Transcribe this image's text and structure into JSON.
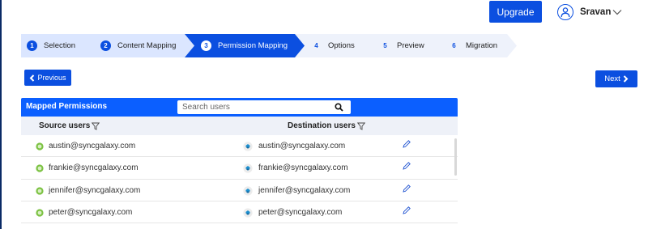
{
  "header": {
    "upgrade_label": "Upgrade",
    "user_name": "Sravan",
    "user_icon": "user-circle-icon",
    "chevron_icon": "chevron-down-icon"
  },
  "stepper": {
    "steps": [
      {
        "number": "1",
        "label": "Selection",
        "state": "completed"
      },
      {
        "number": "2",
        "label": "Content Mapping",
        "state": "completed"
      },
      {
        "number": "3",
        "label": "Permission Mapping",
        "state": "active"
      },
      {
        "number": "4",
        "label": "Options",
        "state": "pending"
      },
      {
        "number": "5",
        "label": "Preview",
        "state": "pending"
      },
      {
        "number": "6",
        "label": "Migration",
        "state": "pending"
      }
    ]
  },
  "nav": {
    "previous_label": "Previous",
    "next_label": "Next"
  },
  "table": {
    "title": "Mapped Permissions",
    "search_placeholder": "Search users",
    "source_header": "Source users",
    "destination_header": "Destination users",
    "rows": [
      {
        "source": "austin@syncgalaxy.com",
        "destination": "austin@syncgalaxy.com"
      },
      {
        "source": "frankie@syncgalaxy.com",
        "destination": "frankie@syncgalaxy.com"
      },
      {
        "source": "jennifer@syncgalaxy.com",
        "destination": "jennifer@syncgalaxy.com"
      },
      {
        "source": "peter@syncgalaxy.com",
        "destination": "peter@syncgalaxy.com"
      }
    ]
  },
  "colors": {
    "primary": "#0b4fe0",
    "panel_header": "#0b5fff",
    "step_completed": "#dbe6ff",
    "step_pending": "#eef2fb"
  }
}
